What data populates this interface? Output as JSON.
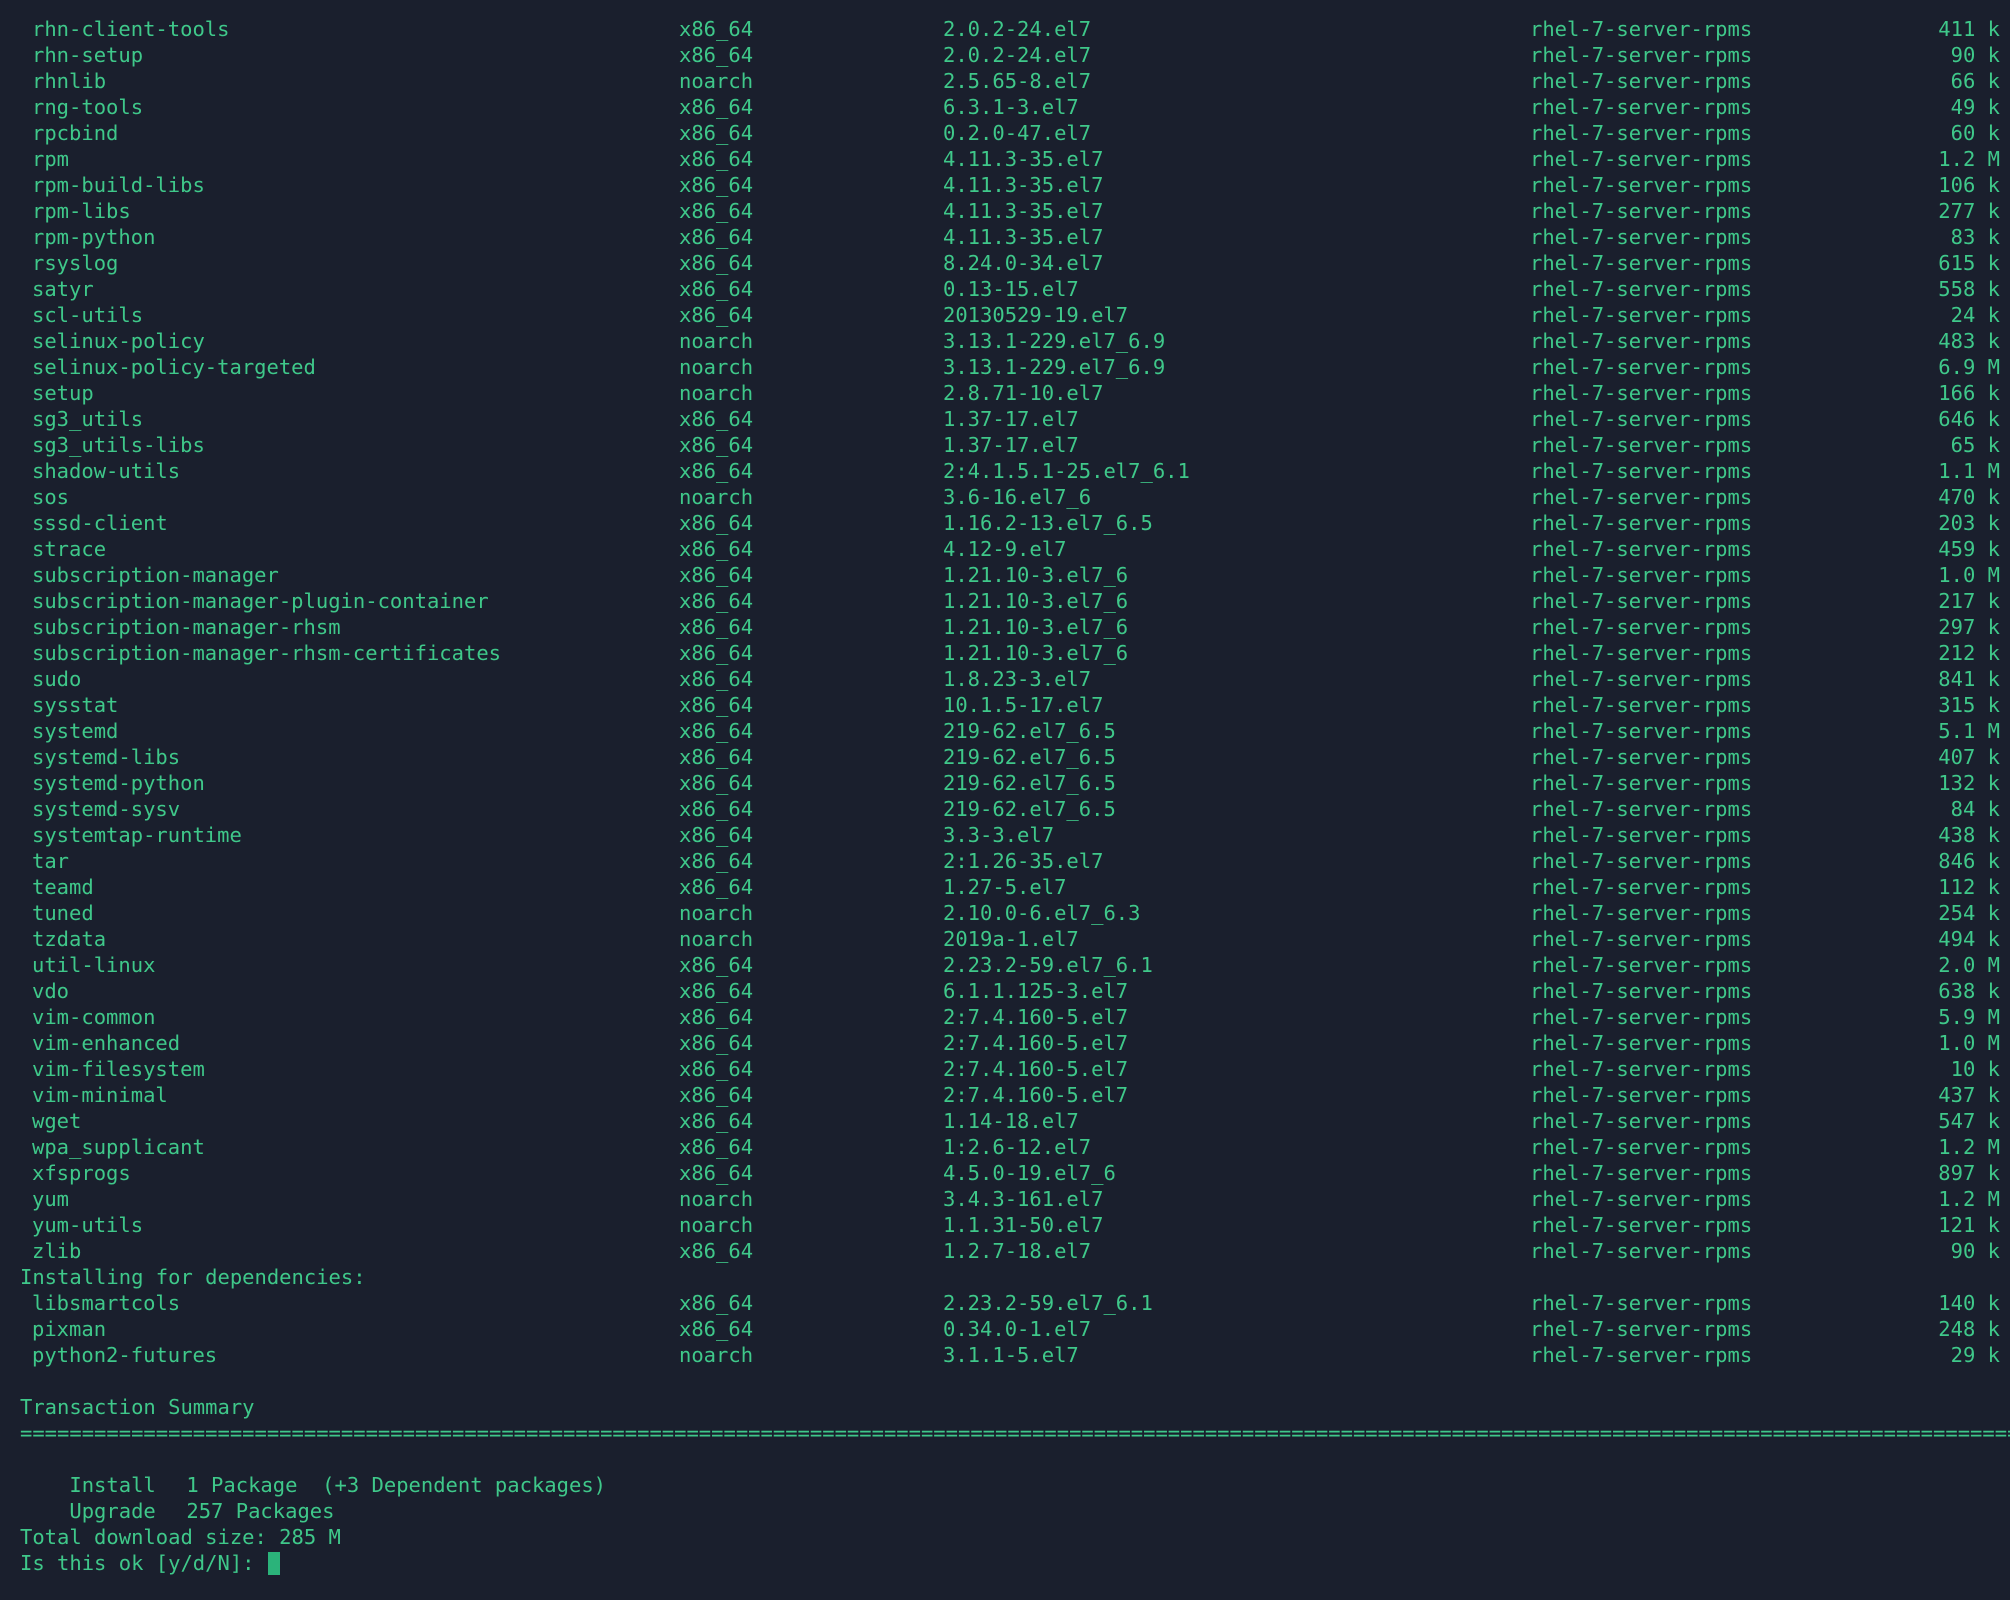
{
  "packages": [
    {
      "name": "rhn-client-tools",
      "arch": "x86_64",
      "version": "2.0.2-24.el7",
      "repo": "rhel-7-server-rpms",
      "size": "411 k"
    },
    {
      "name": "rhn-setup",
      "arch": "x86_64",
      "version": "2.0.2-24.el7",
      "repo": "rhel-7-server-rpms",
      "size": "90 k"
    },
    {
      "name": "rhnlib",
      "arch": "noarch",
      "version": "2.5.65-8.el7",
      "repo": "rhel-7-server-rpms",
      "size": "66 k"
    },
    {
      "name": "rng-tools",
      "arch": "x86_64",
      "version": "6.3.1-3.el7",
      "repo": "rhel-7-server-rpms",
      "size": "49 k"
    },
    {
      "name": "rpcbind",
      "arch": "x86_64",
      "version": "0.2.0-47.el7",
      "repo": "rhel-7-server-rpms",
      "size": "60 k"
    },
    {
      "name": "rpm",
      "arch": "x86_64",
      "version": "4.11.3-35.el7",
      "repo": "rhel-7-server-rpms",
      "size": "1.2 M"
    },
    {
      "name": "rpm-build-libs",
      "arch": "x86_64",
      "version": "4.11.3-35.el7",
      "repo": "rhel-7-server-rpms",
      "size": "106 k"
    },
    {
      "name": "rpm-libs",
      "arch": "x86_64",
      "version": "4.11.3-35.el7",
      "repo": "rhel-7-server-rpms",
      "size": "277 k"
    },
    {
      "name": "rpm-python",
      "arch": "x86_64",
      "version": "4.11.3-35.el7",
      "repo": "rhel-7-server-rpms",
      "size": "83 k"
    },
    {
      "name": "rsyslog",
      "arch": "x86_64",
      "version": "8.24.0-34.el7",
      "repo": "rhel-7-server-rpms",
      "size": "615 k"
    },
    {
      "name": "satyr",
      "arch": "x86_64",
      "version": "0.13-15.el7",
      "repo": "rhel-7-server-rpms",
      "size": "558 k"
    },
    {
      "name": "scl-utils",
      "arch": "x86_64",
      "version": "20130529-19.el7",
      "repo": "rhel-7-server-rpms",
      "size": "24 k"
    },
    {
      "name": "selinux-policy",
      "arch": "noarch",
      "version": "3.13.1-229.el7_6.9",
      "repo": "rhel-7-server-rpms",
      "size": "483 k"
    },
    {
      "name": "selinux-policy-targeted",
      "arch": "noarch",
      "version": "3.13.1-229.el7_6.9",
      "repo": "rhel-7-server-rpms",
      "size": "6.9 M"
    },
    {
      "name": "setup",
      "arch": "noarch",
      "version": "2.8.71-10.el7",
      "repo": "rhel-7-server-rpms",
      "size": "166 k"
    },
    {
      "name": "sg3_utils",
      "arch": "x86_64",
      "version": "1.37-17.el7",
      "repo": "rhel-7-server-rpms",
      "size": "646 k"
    },
    {
      "name": "sg3_utils-libs",
      "arch": "x86_64",
      "version": "1.37-17.el7",
      "repo": "rhel-7-server-rpms",
      "size": "65 k"
    },
    {
      "name": "shadow-utils",
      "arch": "x86_64",
      "version": "2:4.1.5.1-25.el7_6.1",
      "repo": "rhel-7-server-rpms",
      "size": "1.1 M"
    },
    {
      "name": "sos",
      "arch": "noarch",
      "version": "3.6-16.el7_6",
      "repo": "rhel-7-server-rpms",
      "size": "470 k"
    },
    {
      "name": "sssd-client",
      "arch": "x86_64",
      "version": "1.16.2-13.el7_6.5",
      "repo": "rhel-7-server-rpms",
      "size": "203 k"
    },
    {
      "name": "strace",
      "arch": "x86_64",
      "version": "4.12-9.el7",
      "repo": "rhel-7-server-rpms",
      "size": "459 k"
    },
    {
      "name": "subscription-manager",
      "arch": "x86_64",
      "version": "1.21.10-3.el7_6",
      "repo": "rhel-7-server-rpms",
      "size": "1.0 M"
    },
    {
      "name": "subscription-manager-plugin-container",
      "arch": "x86_64",
      "version": "1.21.10-3.el7_6",
      "repo": "rhel-7-server-rpms",
      "size": "217 k"
    },
    {
      "name": "subscription-manager-rhsm",
      "arch": "x86_64",
      "version": "1.21.10-3.el7_6",
      "repo": "rhel-7-server-rpms",
      "size": "297 k"
    },
    {
      "name": "subscription-manager-rhsm-certificates",
      "arch": "x86_64",
      "version": "1.21.10-3.el7_6",
      "repo": "rhel-7-server-rpms",
      "size": "212 k"
    },
    {
      "name": "sudo",
      "arch": "x86_64",
      "version": "1.8.23-3.el7",
      "repo": "rhel-7-server-rpms",
      "size": "841 k"
    },
    {
      "name": "sysstat",
      "arch": "x86_64",
      "version": "10.1.5-17.el7",
      "repo": "rhel-7-server-rpms",
      "size": "315 k"
    },
    {
      "name": "systemd",
      "arch": "x86_64",
      "version": "219-62.el7_6.5",
      "repo": "rhel-7-server-rpms",
      "size": "5.1 M"
    },
    {
      "name": "systemd-libs",
      "arch": "x86_64",
      "version": "219-62.el7_6.5",
      "repo": "rhel-7-server-rpms",
      "size": "407 k"
    },
    {
      "name": "systemd-python",
      "arch": "x86_64",
      "version": "219-62.el7_6.5",
      "repo": "rhel-7-server-rpms",
      "size": "132 k"
    },
    {
      "name": "systemd-sysv",
      "arch": "x86_64",
      "version": "219-62.el7_6.5",
      "repo": "rhel-7-server-rpms",
      "size": "84 k"
    },
    {
      "name": "systemtap-runtime",
      "arch": "x86_64",
      "version": "3.3-3.el7",
      "repo": "rhel-7-server-rpms",
      "size": "438 k"
    },
    {
      "name": "tar",
      "arch": "x86_64",
      "version": "2:1.26-35.el7",
      "repo": "rhel-7-server-rpms",
      "size": "846 k"
    },
    {
      "name": "teamd",
      "arch": "x86_64",
      "version": "1.27-5.el7",
      "repo": "rhel-7-server-rpms",
      "size": "112 k"
    },
    {
      "name": "tuned",
      "arch": "noarch",
      "version": "2.10.0-6.el7_6.3",
      "repo": "rhel-7-server-rpms",
      "size": "254 k"
    },
    {
      "name": "tzdata",
      "arch": "noarch",
      "version": "2019a-1.el7",
      "repo": "rhel-7-server-rpms",
      "size": "494 k"
    },
    {
      "name": "util-linux",
      "arch": "x86_64",
      "version": "2.23.2-59.el7_6.1",
      "repo": "rhel-7-server-rpms",
      "size": "2.0 M"
    },
    {
      "name": "vdo",
      "arch": "x86_64",
      "version": "6.1.1.125-3.el7",
      "repo": "rhel-7-server-rpms",
      "size": "638 k"
    },
    {
      "name": "vim-common",
      "arch": "x86_64",
      "version": "2:7.4.160-5.el7",
      "repo": "rhel-7-server-rpms",
      "size": "5.9 M"
    },
    {
      "name": "vim-enhanced",
      "arch": "x86_64",
      "version": "2:7.4.160-5.el7",
      "repo": "rhel-7-server-rpms",
      "size": "1.0 M"
    },
    {
      "name": "vim-filesystem",
      "arch": "x86_64",
      "version": "2:7.4.160-5.el7",
      "repo": "rhel-7-server-rpms",
      "size": "10 k"
    },
    {
      "name": "vim-minimal",
      "arch": "x86_64",
      "version": "2:7.4.160-5.el7",
      "repo": "rhel-7-server-rpms",
      "size": "437 k"
    },
    {
      "name": "wget",
      "arch": "x86_64",
      "version": "1.14-18.el7",
      "repo": "rhel-7-server-rpms",
      "size": "547 k"
    },
    {
      "name": "wpa_supplicant",
      "arch": "x86_64",
      "version": "1:2.6-12.el7",
      "repo": "rhel-7-server-rpms",
      "size": "1.2 M"
    },
    {
      "name": "xfsprogs",
      "arch": "x86_64",
      "version": "4.5.0-19.el7_6",
      "repo": "rhel-7-server-rpms",
      "size": "897 k"
    },
    {
      "name": "yum",
      "arch": "noarch",
      "version": "3.4.3-161.el7",
      "repo": "rhel-7-server-rpms",
      "size": "1.2 M"
    },
    {
      "name": "yum-utils",
      "arch": "noarch",
      "version": "1.1.31-50.el7",
      "repo": "rhel-7-server-rpms",
      "size": "121 k"
    },
    {
      "name": "zlib",
      "arch": "x86_64",
      "version": "1.2.7-18.el7",
      "repo": "rhel-7-server-rpms",
      "size": "90 k"
    }
  ],
  "dependencies_header": "Installing for dependencies:",
  "dependencies": [
    {
      "name": "libsmartcols",
      "arch": "x86_64",
      "version": "2.23.2-59.el7_6.1",
      "repo": "rhel-7-server-rpms",
      "size": "140 k"
    },
    {
      "name": "pixman",
      "arch": "x86_64",
      "version": "0.34.0-1.el7",
      "repo": "rhel-7-server-rpms",
      "size": "248 k"
    },
    {
      "name": "python2-futures",
      "arch": "noarch",
      "version": "3.1.1-5.el7",
      "repo": "rhel-7-server-rpms",
      "size": "29 k"
    }
  ],
  "summary": {
    "title": "Transaction Summary",
    "separator": "=======================================================================================================================================================================================================================",
    "install_label": "Install",
    "install_count": "1 Package  (+3 Dependent packages)",
    "upgrade_label": "Upgrade",
    "upgrade_count": "257 Packages",
    "total_download": "Total download size: 285 M",
    "prompt": "Is this ok [y/d/N]: "
  },
  "colors": {
    "background": "#1a1f2d",
    "text": "#3fc88a",
    "cursor": "#2bb37a"
  }
}
